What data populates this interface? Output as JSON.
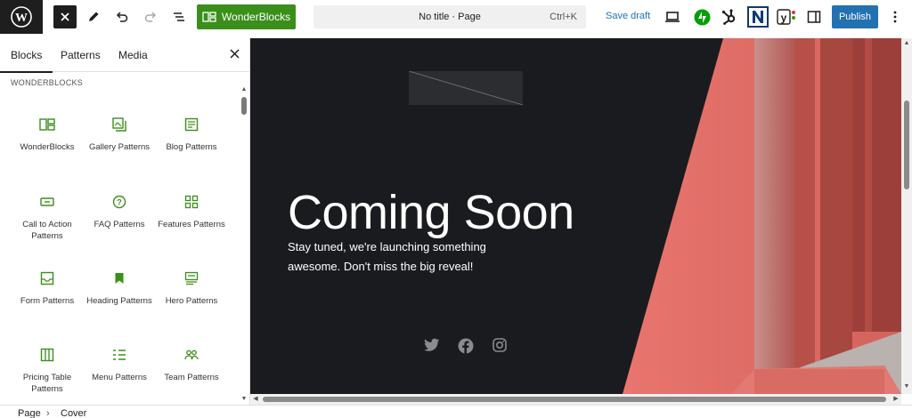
{
  "toolbar": {
    "close_icon": "close-icon",
    "wonderblocks_label": "WonderBlocks",
    "command_title": "No title · Page",
    "command_shortcut": "Ctrl+K",
    "save_draft_label": "Save draft",
    "publish_label": "Publish",
    "accent_color": "#2271b1",
    "wonderblocks_color": "#3a8f1b"
  },
  "sidebar": {
    "tabs": [
      {
        "label": "Blocks",
        "active": true
      },
      {
        "label": "Patterns",
        "active": false
      },
      {
        "label": "Media",
        "active": false
      }
    ],
    "category": "WONDERBLOCKS",
    "items": [
      {
        "label": "WonderBlocks",
        "icon": "wonderblocks-icon"
      },
      {
        "label": "Gallery Patterns",
        "icon": "gallery-icon"
      },
      {
        "label": "Blog Patterns",
        "icon": "blog-icon"
      },
      {
        "label": "Call to Action Patterns",
        "icon": "call-to-action-icon"
      },
      {
        "label": "FAQ Patterns",
        "icon": "faq-icon"
      },
      {
        "label": "Features Patterns",
        "icon": "features-icon"
      },
      {
        "label": "Form Patterns",
        "icon": "form-icon"
      },
      {
        "label": "Heading Patterns",
        "icon": "bookmark-icon"
      },
      {
        "label": "Hero Patterns",
        "icon": "hero-icon"
      },
      {
        "label": "Pricing Table Patterns",
        "icon": "pricing-table-icon"
      },
      {
        "label": "Menu Patterns",
        "icon": "menu-icon"
      },
      {
        "label": "Team Patterns",
        "icon": "team-icon"
      }
    ]
  },
  "canvas": {
    "headline": "Coming Soon",
    "tagline": "Stay tuned, we're launching something awesome. Don't miss the big reveal!",
    "social": [
      "twitter-icon",
      "facebook-icon",
      "instagram-icon"
    ],
    "background_color": "#1a1b1e",
    "accent_wall_color": "#e8756e"
  },
  "breadcrumb": [
    "Page",
    "Cover"
  ]
}
